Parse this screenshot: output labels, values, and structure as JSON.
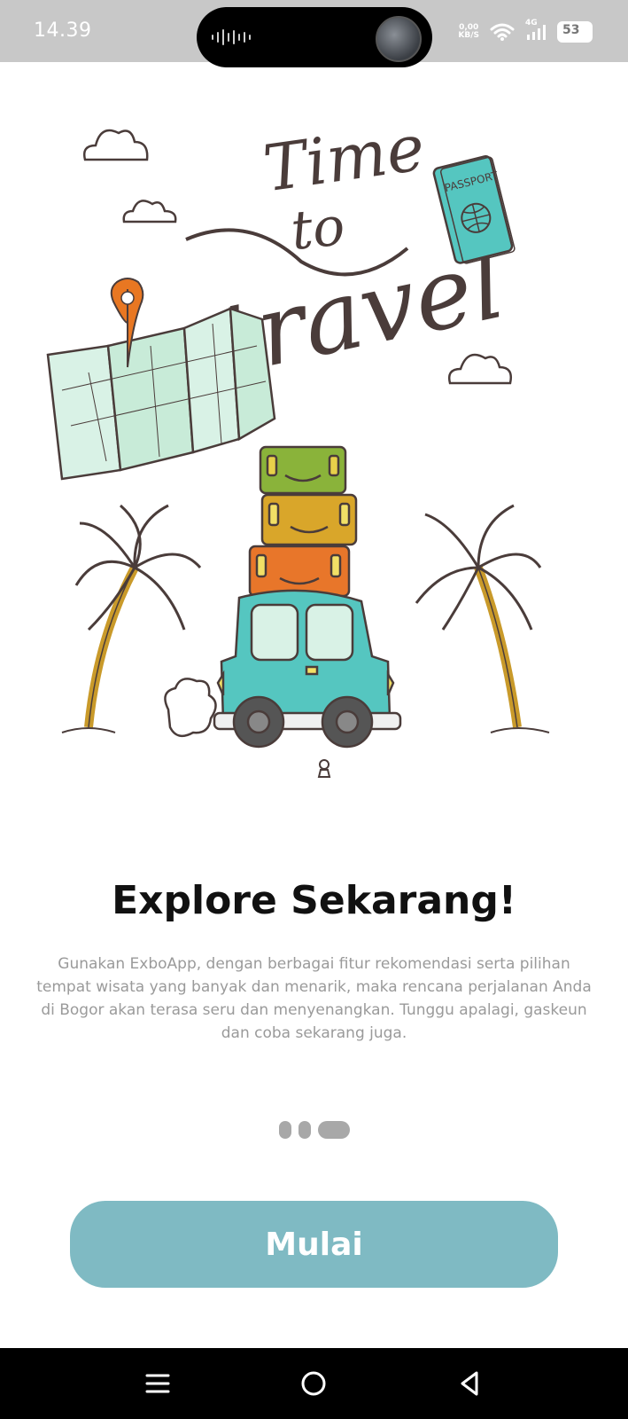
{
  "status_bar": {
    "time": "14.39",
    "net_speed_value": "0,00",
    "net_speed_unit": "KB/S",
    "network_type": "4G",
    "battery": "53"
  },
  "illustration": {
    "headline_line1": "Time",
    "headline_line2": "to",
    "headline_line3": "travel",
    "passport_label": "PASSPORT",
    "colors": {
      "ink": "#4a3c3a",
      "teal": "#55c6c0",
      "mint": "#d9f2e6",
      "pin": "#e87722",
      "green_case": "#8ab33a",
      "mustard_case": "#d9a62a",
      "orange_case": "#e8762a",
      "trunk": "#c99a2a",
      "tire": "#555555"
    }
  },
  "onboarding": {
    "title": "Explore Sekarang!",
    "description": "Gunakan ExboApp, dengan berbagai fitur rekomendasi serta pilihan tempat wisata yang banyak dan menarik, maka rencana perjalanan Anda di Bogor akan terasa seru dan menyenangkan. Tunggu apalagi, gaskeun dan coba sekarang juga.",
    "page_count": 3,
    "active_page": 3,
    "cta_label": "Mulai",
    "cta_color": "#7fbac3"
  },
  "nav_bar": {
    "icons": [
      "menu-icon",
      "home-circle-icon",
      "back-triangle-icon"
    ]
  }
}
